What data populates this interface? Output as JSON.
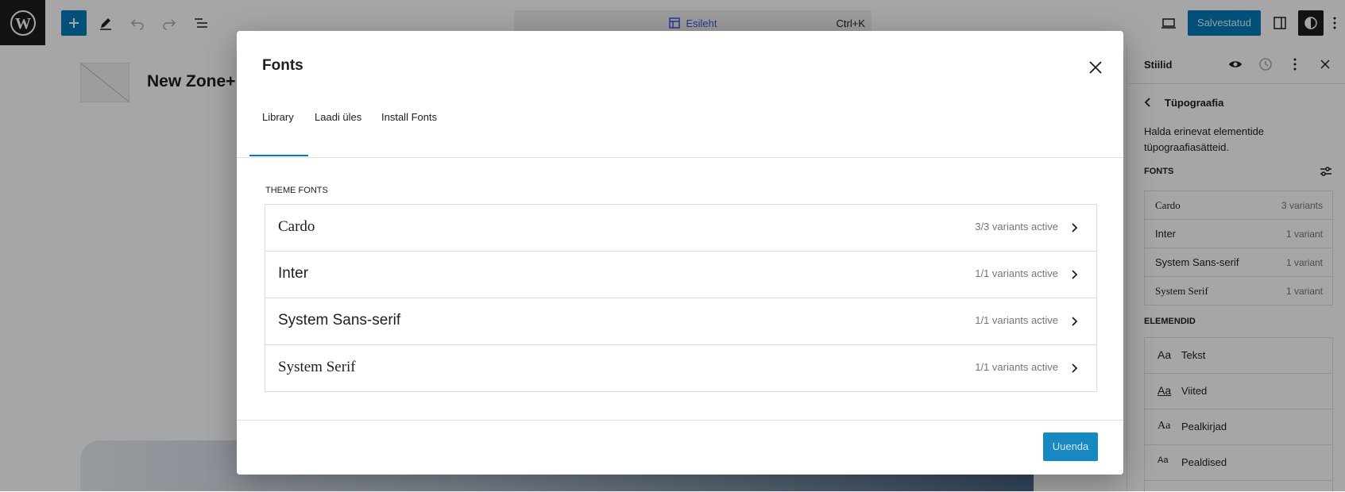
{
  "topbar": {
    "command": {
      "title": "Esileht",
      "shortcut": "Ctrl+K"
    },
    "save_label": "Salvestatud"
  },
  "canvas": {
    "site_title": "New Zone+ ..."
  },
  "sidebar": {
    "title": "Stiilid",
    "subtitle": "Tüpograafia",
    "description": "Halda erinevat elementide tüpograafiasätteid.",
    "fonts_label": "FONTS",
    "fonts": [
      {
        "name": "Cardo",
        "count": "3 variants"
      },
      {
        "name": "Inter",
        "count": "1 variant"
      },
      {
        "name": "System Sans-serif",
        "count": "1 variant"
      },
      {
        "name": "System Serif",
        "count": "1 variant"
      }
    ],
    "elements_label": "ELEMENDID",
    "elements": [
      {
        "icon": "Aa",
        "label": "Tekst"
      },
      {
        "icon": "Aa",
        "label": "Viited"
      },
      {
        "icon": "Aa",
        "label": "Pealkirjad"
      },
      {
        "icon": "Aa",
        "label": "Pealdised"
      }
    ]
  },
  "modal": {
    "title": "Fonts",
    "tabs": [
      {
        "label": "Library",
        "active": true
      },
      {
        "label": "Laadi üles",
        "active": false
      },
      {
        "label": "Install Fonts",
        "active": false
      }
    ],
    "section_label": "THEME FONTS",
    "fonts": [
      {
        "name": "Cardo",
        "meta": "3/3 variants active"
      },
      {
        "name": "Inter",
        "meta": "1/1 variants active"
      },
      {
        "name": "System Sans-serif",
        "meta": "1/1 variants active"
      },
      {
        "name": "System Serif",
        "meta": "1/1 variants active"
      }
    ],
    "update_label": "Uuenda"
  },
  "colors": {
    "accent": "#007cba",
    "dark": "#1e1e1e",
    "command_accent": "#3858e9"
  }
}
